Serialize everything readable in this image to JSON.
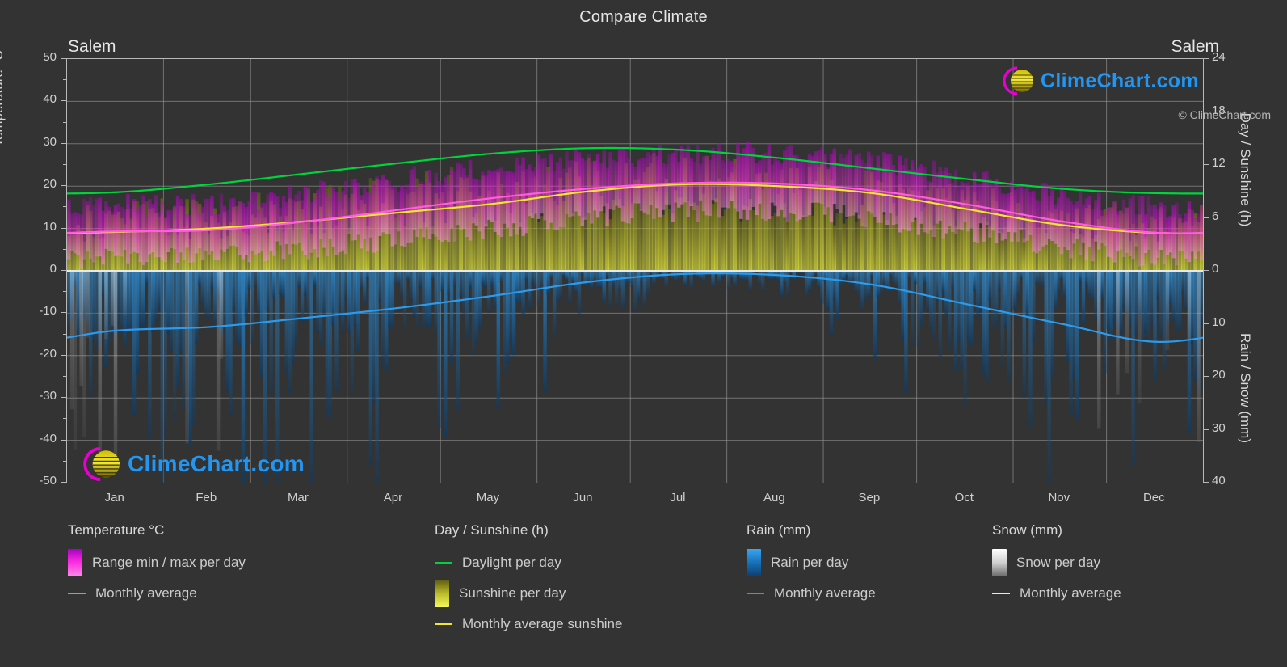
{
  "header": {
    "title": "Compare Climate",
    "location_left": "Salem",
    "location_right": "Salem"
  },
  "axes": {
    "left_title": "Temperature °C",
    "right_title_top": "Day / Sunshine (h)",
    "right_title_bottom": "Rain / Snow (mm)",
    "left_ticks": [
      "50",
      "40",
      "30",
      "20",
      "10",
      "0",
      "-10",
      "-20",
      "-30",
      "-40",
      "-50"
    ],
    "right_ticks_top": [
      "24",
      "18",
      "12",
      "6",
      "0"
    ],
    "right_ticks_bottom": [
      "10",
      "20",
      "30",
      "40"
    ],
    "x_ticks": [
      "Jan",
      "Feb",
      "Mar",
      "Apr",
      "May",
      "Jun",
      "Jul",
      "Aug",
      "Sep",
      "Oct",
      "Nov",
      "Dec"
    ]
  },
  "legend": {
    "groups": [
      {
        "title": "Temperature °C",
        "items": [
          {
            "label": "Range min / max per day",
            "type": "swatch",
            "color": "#ff00e0"
          },
          {
            "label": "Monthly average",
            "type": "line",
            "color": "#ff5ce0"
          }
        ]
      },
      {
        "title": "Day / Sunshine (h)",
        "items": [
          {
            "label": "Daylight per day",
            "type": "line",
            "color": "#00d43c"
          },
          {
            "label": "Sunshine per day",
            "type": "swatch",
            "color": "#f2f53a"
          },
          {
            "label": "Monthly average sunshine",
            "type": "line",
            "color": "#f2e432"
          }
        ]
      },
      {
        "title": "Rain (mm)",
        "items": [
          {
            "label": "Rain per day",
            "type": "swatch",
            "color": "#1b8ae6"
          },
          {
            "label": "Monthly average",
            "type": "line",
            "color": "#2e9bea"
          }
        ]
      },
      {
        "title": "Snow (mm)",
        "items": [
          {
            "label": "Snow per day",
            "type": "swatch",
            "color": "#f5f5f5"
          },
          {
            "label": "Monthly average",
            "type": "line",
            "color": "#e8e8e8"
          }
        ]
      }
    ]
  },
  "watermark": {
    "text": "ClimeChart.com",
    "copyright": "© ClimeChart.com"
  },
  "colors": {
    "background": "#333333",
    "grid": "#9a9a9a",
    "temp_range": "#ff00e0",
    "temp_avg": "#ff5ce0",
    "daylight": "#00d43c",
    "sunshine": "#f2f53a",
    "sunshine_avg": "#f2e432",
    "rain": "#1b8ae6",
    "rain_avg": "#2e9bea",
    "snow": "#f5f5f5",
    "logo_blue": "#2196f3",
    "logo_magenta": "#e800d0",
    "logo_yellow": "#e8d800"
  },
  "chart_data": {
    "type": "line",
    "title": "Compare Climate",
    "subtitle": "Salem",
    "xlabel": "",
    "ylabel": "Temperature °C",
    "y2label_top": "Day / Sunshine (h)",
    "y2label_bottom": "Rain / Snow (mm)",
    "ylim": [
      -50,
      50
    ],
    "y2lim_top": [
      0,
      24
    ],
    "y2lim_bottom": [
      0,
      40
    ],
    "grid": true,
    "legend_position": "bottom",
    "categories": [
      "Jan",
      "Feb",
      "Mar",
      "Apr",
      "May",
      "Jun",
      "Jul",
      "Aug",
      "Sep",
      "Oct",
      "Nov",
      "Dec"
    ],
    "series": [
      {
        "name": "Daylight per day",
        "unit": "h",
        "axis": "right-top",
        "color": "#00d43c",
        "values": [
          8.9,
          9.8,
          11.0,
          12.2,
          13.3,
          13.9,
          13.7,
          12.8,
          11.6,
          10.4,
          9.3,
          8.8
        ]
      },
      {
        "name": "Monthly average sunshine",
        "unit": "h",
        "axis": "right-top",
        "color": "#f2e432",
        "values": [
          4.4,
          4.8,
          5.6,
          6.6,
          7.6,
          9.0,
          9.8,
          9.6,
          8.8,
          7.0,
          5.2,
          4.3
        ]
      },
      {
        "name": "Monthly average temperature",
        "unit": "°C",
        "axis": "left",
        "color": "#ff5ce0",
        "values": [
          9.3,
          9.6,
          11.6,
          14.4,
          17.2,
          19.4,
          20.7,
          20.6,
          19.0,
          15.7,
          11.7,
          9.0
        ]
      },
      {
        "name": "Monthly average rain",
        "unit": "mm",
        "axis": "right-bottom",
        "color": "#2e9bea",
        "values": [
          11.3,
          10.6,
          8.9,
          7.0,
          4.7,
          2.1,
          0.6,
          0.8,
          2.6,
          6.3,
          10.0,
          13.4
        ]
      }
    ],
    "bands": [
      {
        "name": "Temperature range min / max per day",
        "unit": "°C",
        "axis": "left",
        "color": "#ff00e0",
        "min": [
          3.3,
          3.6,
          5.1,
          7.4,
          10.1,
          12.4,
          14.1,
          14.2,
          12.4,
          9.3,
          5.7,
          3.3
        ],
        "max": [
          15.3,
          15.8,
          18.2,
          21.5,
          24.4,
          26.7,
          27.6,
          27.4,
          25.9,
          22.3,
          18.0,
          15.1
        ]
      },
      {
        "name": "Sunshine per day",
        "unit": "h",
        "axis": "right-top",
        "color": "#f2f53a",
        "min": [
          0,
          0,
          0,
          0,
          0,
          0,
          0,
          0,
          0,
          0,
          0,
          0
        ],
        "max": [
          7.5,
          8.0,
          9.0,
          10.4,
          11.6,
          12.6,
          12.6,
          12.0,
          10.8,
          9.2,
          7.8,
          7.2
        ]
      },
      {
        "name": "Rain per day",
        "unit": "mm",
        "axis": "right-bottom",
        "color": "#1b8ae6",
        "min": [
          0,
          0,
          0,
          0,
          0,
          0,
          0,
          0,
          0,
          0,
          0,
          0
        ],
        "max": [
          38,
          42,
          36,
          30,
          24,
          12,
          5,
          6,
          14,
          26,
          34,
          40
        ]
      }
    ]
  }
}
